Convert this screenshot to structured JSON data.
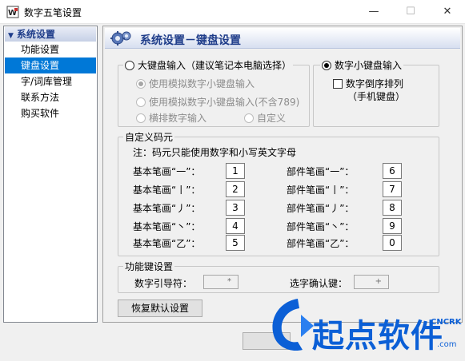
{
  "window": {
    "title": "数字五笔设置"
  },
  "sidebar": {
    "header": "系统设置",
    "items": [
      {
        "label": "功能设置"
      },
      {
        "label": "键盘设置"
      },
      {
        "label": "字/词库管理"
      },
      {
        "label": "联系方法"
      },
      {
        "label": "购买软件"
      }
    ],
    "selected": "键盘设置"
  },
  "panel": {
    "title": "系统设置－键盘设置"
  },
  "big_keyboard": {
    "label": "大键盘输入（建议笔记本电脑选择）",
    "options": [
      "使用模拟数字小键盘输入",
      "使用模拟数字小键盘输入(不含789)",
      "横排数字输入",
      "自定义"
    ]
  },
  "numpad": {
    "label": "数字小键盘输入",
    "reverse_label": "数字倒序排列",
    "reverse_sub": "（手机键盘）"
  },
  "custom_codes": {
    "legend": "自定义码元",
    "note": "注：码元只能使用数字和小写英文字母",
    "basic": [
      {
        "label": "基本笔画“一”：",
        "value": "1"
      },
      {
        "label": "基本笔画“丨”：",
        "value": "2"
      },
      {
        "label": "基本笔画“丿”：",
        "value": "3"
      },
      {
        "label": "基本笔画“丶”：",
        "value": "4"
      },
      {
        "label": "基本笔画“乙”：",
        "value": "5"
      }
    ],
    "parts": [
      {
        "label": "部件笔画“一”：",
        "value": "6"
      },
      {
        "label": "部件笔画“丨”：",
        "value": "7"
      },
      {
        "label": "部件笔画“丿”：",
        "value": "8"
      },
      {
        "label": "部件笔画“丶”：",
        "value": "9"
      },
      {
        "label": "部件笔画“乙”：",
        "value": "0"
      }
    ]
  },
  "function_keys": {
    "legend": "功能键设置",
    "guide_label": "数字引导符：",
    "guide_value": "*",
    "confirm_label": "选字确认键：",
    "confirm_value": "+"
  },
  "restore_button": "恢复默认设置",
  "watermark": {
    "text": "起点软件",
    "brand": "CNCRK",
    "domain": ".com"
  },
  "colors": {
    "selection": "#0078d7",
    "title_blue": "#1f3d8a",
    "watermark": "#0b5fd6"
  }
}
